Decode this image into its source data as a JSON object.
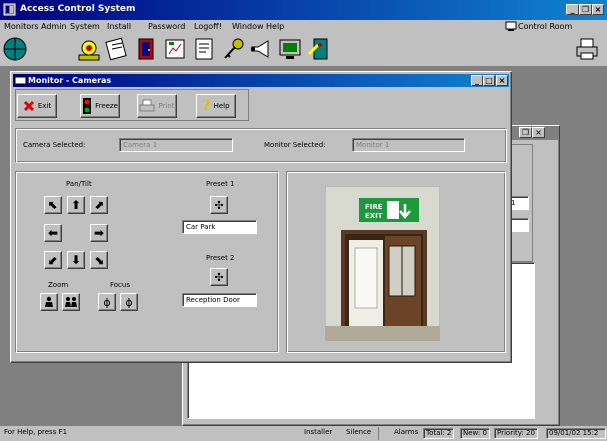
{
  "window": {
    "title": "Access Control System",
    "controls": [
      "_",
      "❐",
      "×"
    ]
  },
  "menu": [
    "Monitors",
    "Admin",
    "System",
    "Install",
    "Password",
    "Logoff!",
    "Window",
    "Help"
  ],
  "control_room": "Control Room",
  "toolbar_icons": [
    "globe-icon",
    "logoff-icon",
    "notes-icon",
    "door-icon",
    "report-icon",
    "document-icon",
    "key-icon",
    "alarm-horn-icon",
    "monitor-icon",
    "door-exit-icon"
  ],
  "bg_window": {
    "controls": [
      "❐",
      "×"
    ],
    "field_value": "1"
  },
  "dialog": {
    "title": "Monitor - Cameras",
    "buttons": {
      "exit": "Exit",
      "freeze": "Freeze",
      "print": "Print",
      "help": "Help"
    },
    "camera_selected_label": "Camera Selected:",
    "camera_selected_value": "Camera 1",
    "monitor_selected_label": "Monitor Selected:",
    "monitor_selected_value": "Monitor 1",
    "pan_tilt_label": "Pan/Tilt",
    "zoom_label": "Zoom",
    "focus_label": "Focus",
    "preset1_label": "Preset 1",
    "preset1_value": "Car Park",
    "preset2_label": "Preset 2",
    "preset2_value": "Reception Door",
    "sign_line1": "FIRE",
    "sign_line2": "EXIT"
  },
  "status": {
    "help": "For Help, press F1",
    "user": "Installer",
    "silence": "Silence",
    "alarms": "Alarms",
    "total": "Total: 2",
    "new": "New: 0",
    "priority": "Priority: 20",
    "datetime": "09/01/02  15:2"
  },
  "colors": {
    "title_start": "#000080",
    "title_end": "#1084d0",
    "face": "#c0c0c0",
    "workspace": "#808080"
  }
}
